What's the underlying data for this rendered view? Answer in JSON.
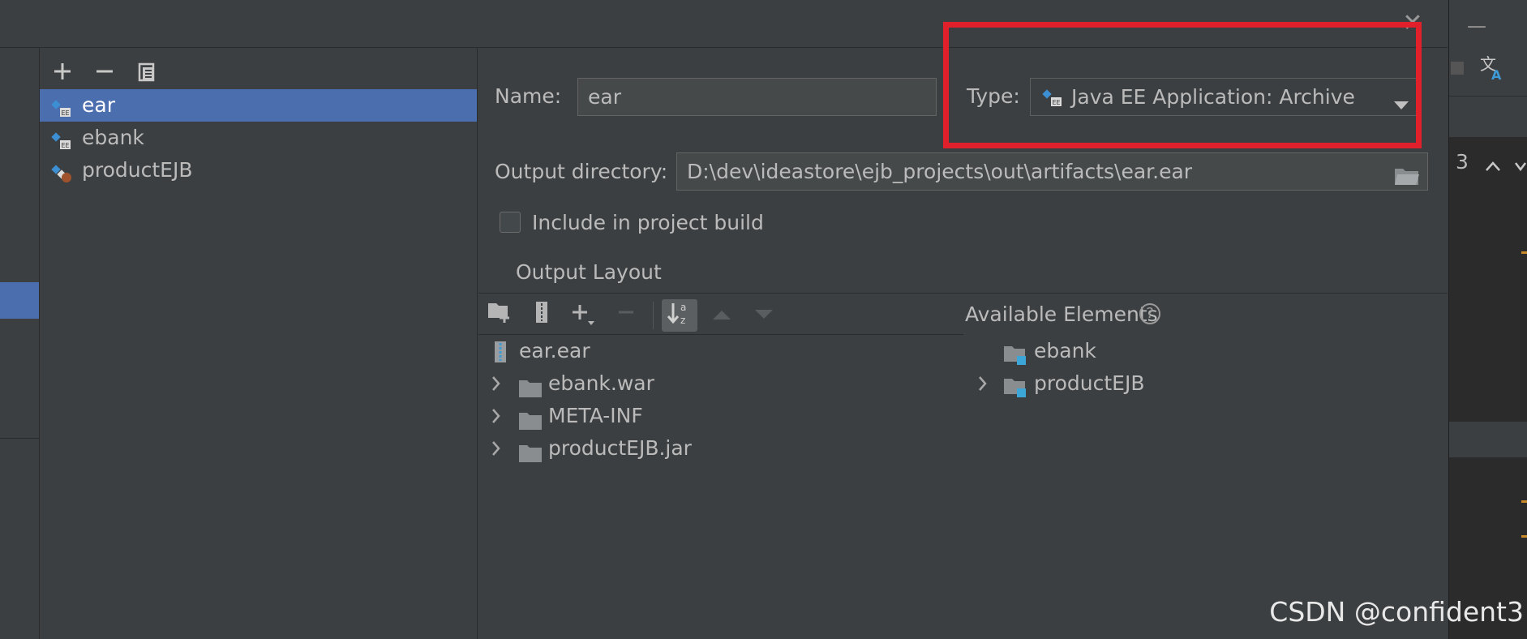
{
  "dialog": {
    "close_glyph": "✕"
  },
  "artifacts": {
    "items": [
      {
        "label": "ear",
        "selected": true,
        "icon": "java-ee-module-icon"
      },
      {
        "label": "ebank",
        "selected": false,
        "icon": "java-ee-module-icon"
      },
      {
        "label": "productEJB",
        "selected": false,
        "icon": "ejb-module-icon"
      }
    ]
  },
  "form": {
    "name_label": "Name:",
    "name_value": "ear",
    "type_label": "Type:",
    "type_value": "Java EE Application: Archive",
    "output_dir_label": "Output directory:",
    "output_dir_value": "D:\\dev\\ideastore\\ejb_projects\\out\\artifacts\\ear.ear",
    "include_label": "Include in project build",
    "include_checked": false,
    "output_layout_tab": "Output Layout"
  },
  "layout_tree": [
    {
      "label": "ear.ear",
      "expandable": false,
      "icon": "archive-icon"
    },
    {
      "label": "ebank.war",
      "expandable": true,
      "icon": "folder-icon"
    },
    {
      "label": "META-INF",
      "expandable": true,
      "icon": "folder-icon"
    },
    {
      "label": "productEJB.jar",
      "expandable": true,
      "icon": "folder-icon"
    }
  ],
  "available": {
    "title": "Available Elements",
    "help_glyph": "?",
    "items": [
      {
        "label": "ebank",
        "expandable": false
      },
      {
        "label": "productEJB",
        "expandable": true
      }
    ]
  },
  "background_app": {
    "counter": "3"
  },
  "watermark": "CSDN @confident3",
  "colors": {
    "selection": "#4b6eaf",
    "highlight_box": "#e0202a",
    "background": "#3c3f41"
  }
}
